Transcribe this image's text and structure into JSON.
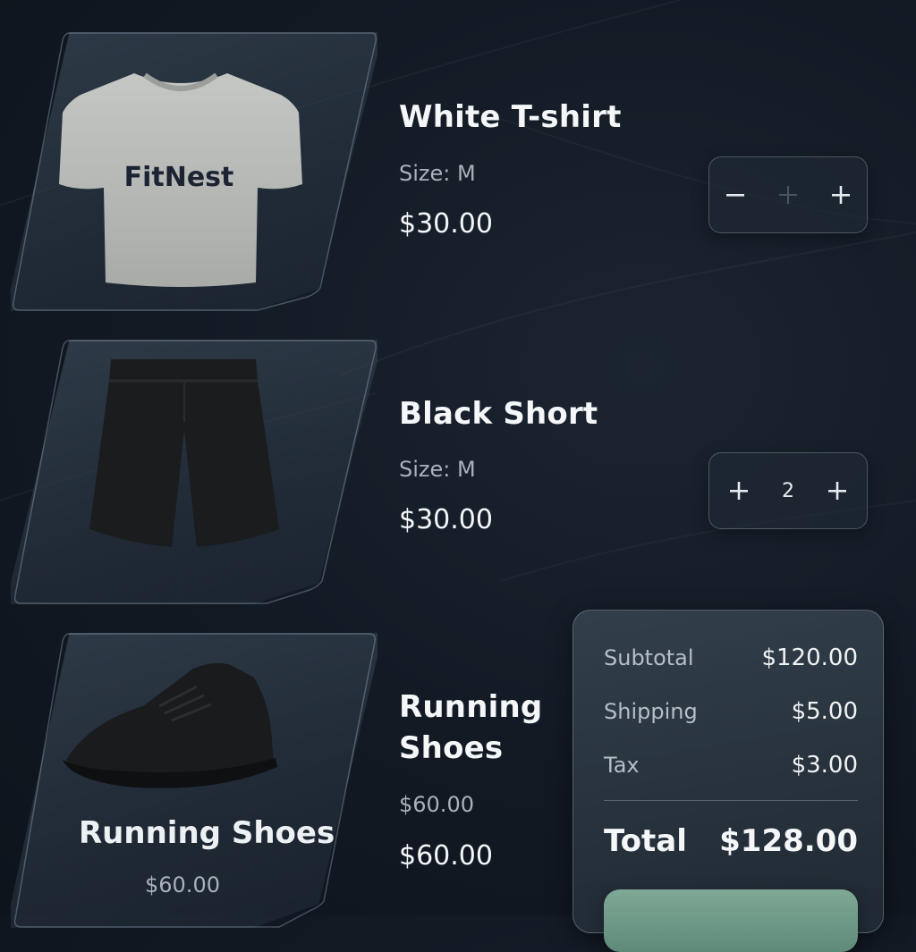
{
  "items": [
    {
      "name": "White T-shirt",
      "size_label": "Size: M",
      "price": "$30.00",
      "qty": "",
      "brand": "FitNest",
      "image_icon": "tshirt-image",
      "decrement_icon": "minus-icon",
      "increment_icon": "plus-icon"
    },
    {
      "name": "Black Short",
      "size_label": "Size: M",
      "price": "$30.00",
      "qty": "2",
      "image_icon": "shorts-image",
      "decrement_icon": "plus-icon",
      "increment_icon": "plus-icon"
    },
    {
      "name_line1": "Running",
      "name_line2": "Shoes",
      "meta_price": "$60.00",
      "price": "$60.00",
      "card_title": "Running Shoes",
      "card_price": "$60.00",
      "image_icon": "sneaker-image"
    }
  ],
  "summary": {
    "subtotal_label": "Subtotal",
    "subtotal_value": "$120.00",
    "shipping_label": "Shipping",
    "shipping_value": "$5.00",
    "tax_label": "Tax",
    "tax_value": "$3.00",
    "total_label": "Total",
    "total_value": "$128.00"
  },
  "colors": {
    "background": "#121923",
    "checkout_accent": "#6f9a88",
    "text_primary": "#f4f6f8",
    "text_secondary": "#a9b1ba"
  }
}
